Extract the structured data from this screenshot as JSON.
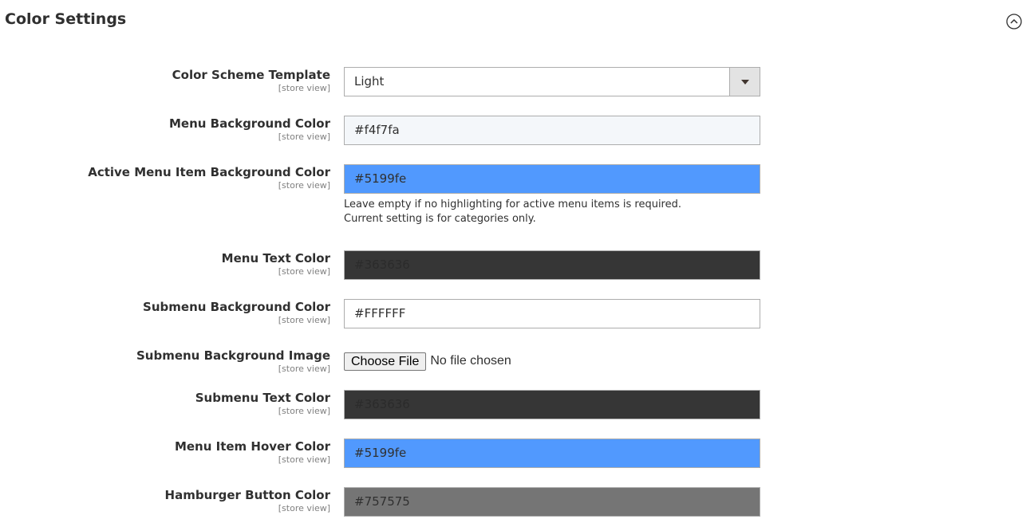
{
  "section": {
    "title": "Color Settings",
    "collapse_icon": "chevron-up-circle-icon"
  },
  "fields": {
    "color_scheme_template": {
      "label": "Color Scheme Template",
      "scope": "[store view]",
      "value": "Light"
    },
    "menu_background_color": {
      "label": "Menu Background Color",
      "scope": "[store view]",
      "value": "#f4f7fa",
      "swatch": "#f4f7fa"
    },
    "active_menu_item_background_color": {
      "label": "Active Menu Item Background Color",
      "scope": "[store view]",
      "value": "#5199fe",
      "swatch": "#5199fe",
      "note_line1": "Leave empty if no highlighting for active menu items is required.",
      "note_line2": "Current setting is for categories only."
    },
    "menu_text_color": {
      "label": "Menu Text Color",
      "scope": "[store view]",
      "value": "#363636",
      "swatch": "#363636"
    },
    "submenu_background_color": {
      "label": "Submenu Background Color",
      "scope": "[store view]",
      "value": "#FFFFFF",
      "swatch": "#ffffff"
    },
    "submenu_background_image": {
      "label": "Submenu Background Image",
      "scope": "[store view]",
      "button_label": "Choose File",
      "status": "No file chosen"
    },
    "submenu_text_color": {
      "label": "Submenu Text Color",
      "scope": "[store view]",
      "value": "#363636",
      "swatch": "#363636"
    },
    "menu_item_hover_color": {
      "label": "Menu Item Hover Color",
      "scope": "[store view]",
      "value": "#5199fe",
      "swatch": "#5199fe"
    },
    "hamburger_button_color": {
      "label": "Hamburger Button Color",
      "scope": "[store view]",
      "value": "#757575",
      "swatch": "#757575"
    }
  }
}
